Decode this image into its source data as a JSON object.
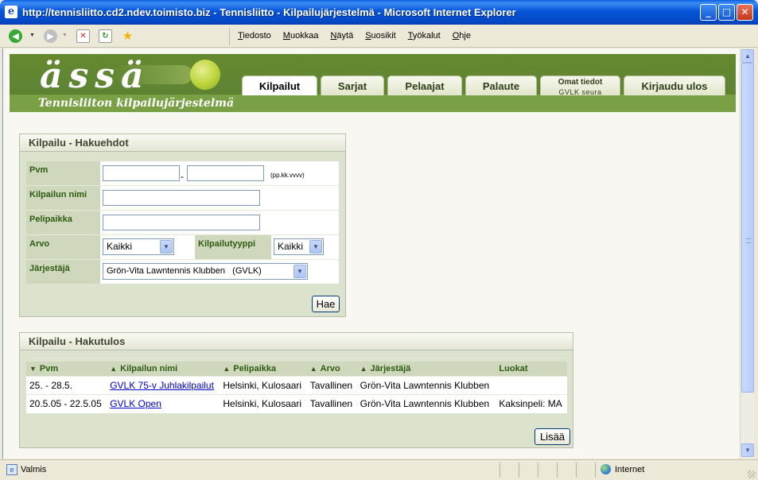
{
  "window": {
    "title": "http://tennisliitto.cd2.ndev.toimisto.biz - Tennisliitto - Kilpailujärjestelmä - Microsoft Internet Explorer",
    "min": "_",
    "max": "□",
    "close": "✕"
  },
  "menubar": [
    "Tiedosto",
    "Muokkaa",
    "Näytä",
    "Suosikit",
    "Työkalut",
    "Ohje"
  ],
  "site": {
    "logo": "ässä",
    "tagline": "Tennisliiton kilpailujärjestelmä",
    "tabs": [
      {
        "label": "Kilpailut",
        "sub": ""
      },
      {
        "label": "Sarjat",
        "sub": ""
      },
      {
        "label": "Pelaajat",
        "sub": ""
      },
      {
        "label": "Palaute",
        "sub": ""
      },
      {
        "label": "Omat tiedot",
        "sub": "GVLK seura"
      },
      {
        "label": "Kirjaudu ulos",
        "sub": ""
      }
    ]
  },
  "search": {
    "heading": "Kilpailu - Hakuehdot",
    "labels": {
      "date": "Pvm",
      "name": "Kilpailun nimi",
      "venue": "Pelipaikka",
      "grade": "Arvo",
      "type": "Kilpailutyyppi",
      "organizer": "Järjestäjä"
    },
    "date_separator": "-",
    "date_hint": "(pp.kk.vvvv)",
    "date_from": "",
    "date_to": "",
    "name_value": "",
    "venue_value": "",
    "grade_value": "Kaikki",
    "type_value": "Kaikki",
    "organizer_value": "Grön-Vita Lawntennis Klubben   (GVLK)",
    "button": "Hae"
  },
  "results": {
    "heading": "Kilpailu - Hakutulos",
    "columns": [
      {
        "label": "Pvm",
        "sort": "▼"
      },
      {
        "label": "Kilpailun nimi",
        "sort": "▲"
      },
      {
        "label": "Pelipaikka",
        "sort": "▲"
      },
      {
        "label": "Arvo",
        "sort": "▲"
      },
      {
        "label": "Järjestäjä",
        "sort": "▲"
      },
      {
        "label": "Luokat",
        "sort": ""
      }
    ],
    "rows": [
      {
        "date": "25. - 28.5.",
        "name": "GVLK 75-v Juhlakilpailut",
        "venue": "Helsinki, Kulosaari",
        "grade": "Tavallinen",
        "organizer": "Grön-Vita Lawntennis Klubben",
        "classes": ""
      },
      {
        "date": "20.5.05 - 22.5.05",
        "name": "GVLK Open",
        "venue": "Helsinki, Kulosaari",
        "grade": "Tavallinen",
        "organizer": "Grön-Vita Lawntennis Klubben",
        "classes": "Kaksinpeli: MA"
      }
    ],
    "button": "Lisää"
  },
  "status": {
    "text": "Valmis",
    "zone": "Internet"
  }
}
